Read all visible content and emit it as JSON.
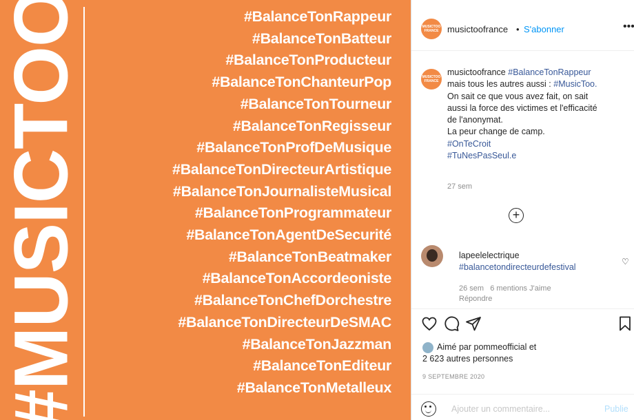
{
  "image": {
    "background_color": "#f28a45",
    "vertical_title": "#MUSICTOO",
    "hashtags": [
      "#BalanceTonRappeur",
      "#BalanceTonBatteur",
      "#BalanceTonProducteur",
      "#BalanceTonChanteurPop",
      "#BalanceTonTourneur",
      "#BalanceTonRegisseur",
      "#BalanceTonProfDeMusique",
      "#BalanceTonDirecteurArtistique",
      "#BalanceTonJournalisteMusical",
      "#BalanceTonProgrammateur",
      "#BalanceTonAgentDeSecurité",
      "#BalanceTonBeatmaker",
      "#BalanceTonAccordeoniste",
      "#BalanceTonChefDorchestre",
      "#BalanceTonDirecteurDeSMAC",
      "#BalanceTonJazzman",
      "#BalanceTonEditeur",
      "#BalanceTonMetalleux"
    ]
  },
  "header": {
    "avatar_text": "MUSICTOO FRANCE",
    "username": "musictoofrance",
    "separator": "•",
    "follow_label": "S'abonner",
    "more_icon": "more-icon"
  },
  "caption": {
    "username": "musictoofrance",
    "tag_1": "#BalanceTonRappeur",
    "line_2a": "mais tous les autres aussi :",
    "tag_2": "#MusicToo.",
    "line_3": "On sait ce que vous avez fait, on sait",
    "line_4": "aussi la force des victimes et l'efficacité",
    "line_5": "de l'anonymat.",
    "line_6": "La peur change de camp.",
    "tag_3": "#OnTeCroit",
    "tag_4": "#TuNesPasSeul.e",
    "time": "27 sem"
  },
  "load_more_icon": "plus-circle-icon",
  "comment": {
    "username": "lapeelelectrique",
    "text": "#balancetondirecteurdefestival",
    "time": "26 sem",
    "likes": "6 mentions J'aime",
    "reply_label": "Répondre"
  },
  "likes": {
    "line_1": "Aimé par pommeofficial et",
    "line_2": "2 623 autres personnes"
  },
  "date": "9 SEPTEMBRE 2020",
  "comment_bar": {
    "placeholder": "Ajouter un commentaire...",
    "publish_label": "Publie"
  }
}
